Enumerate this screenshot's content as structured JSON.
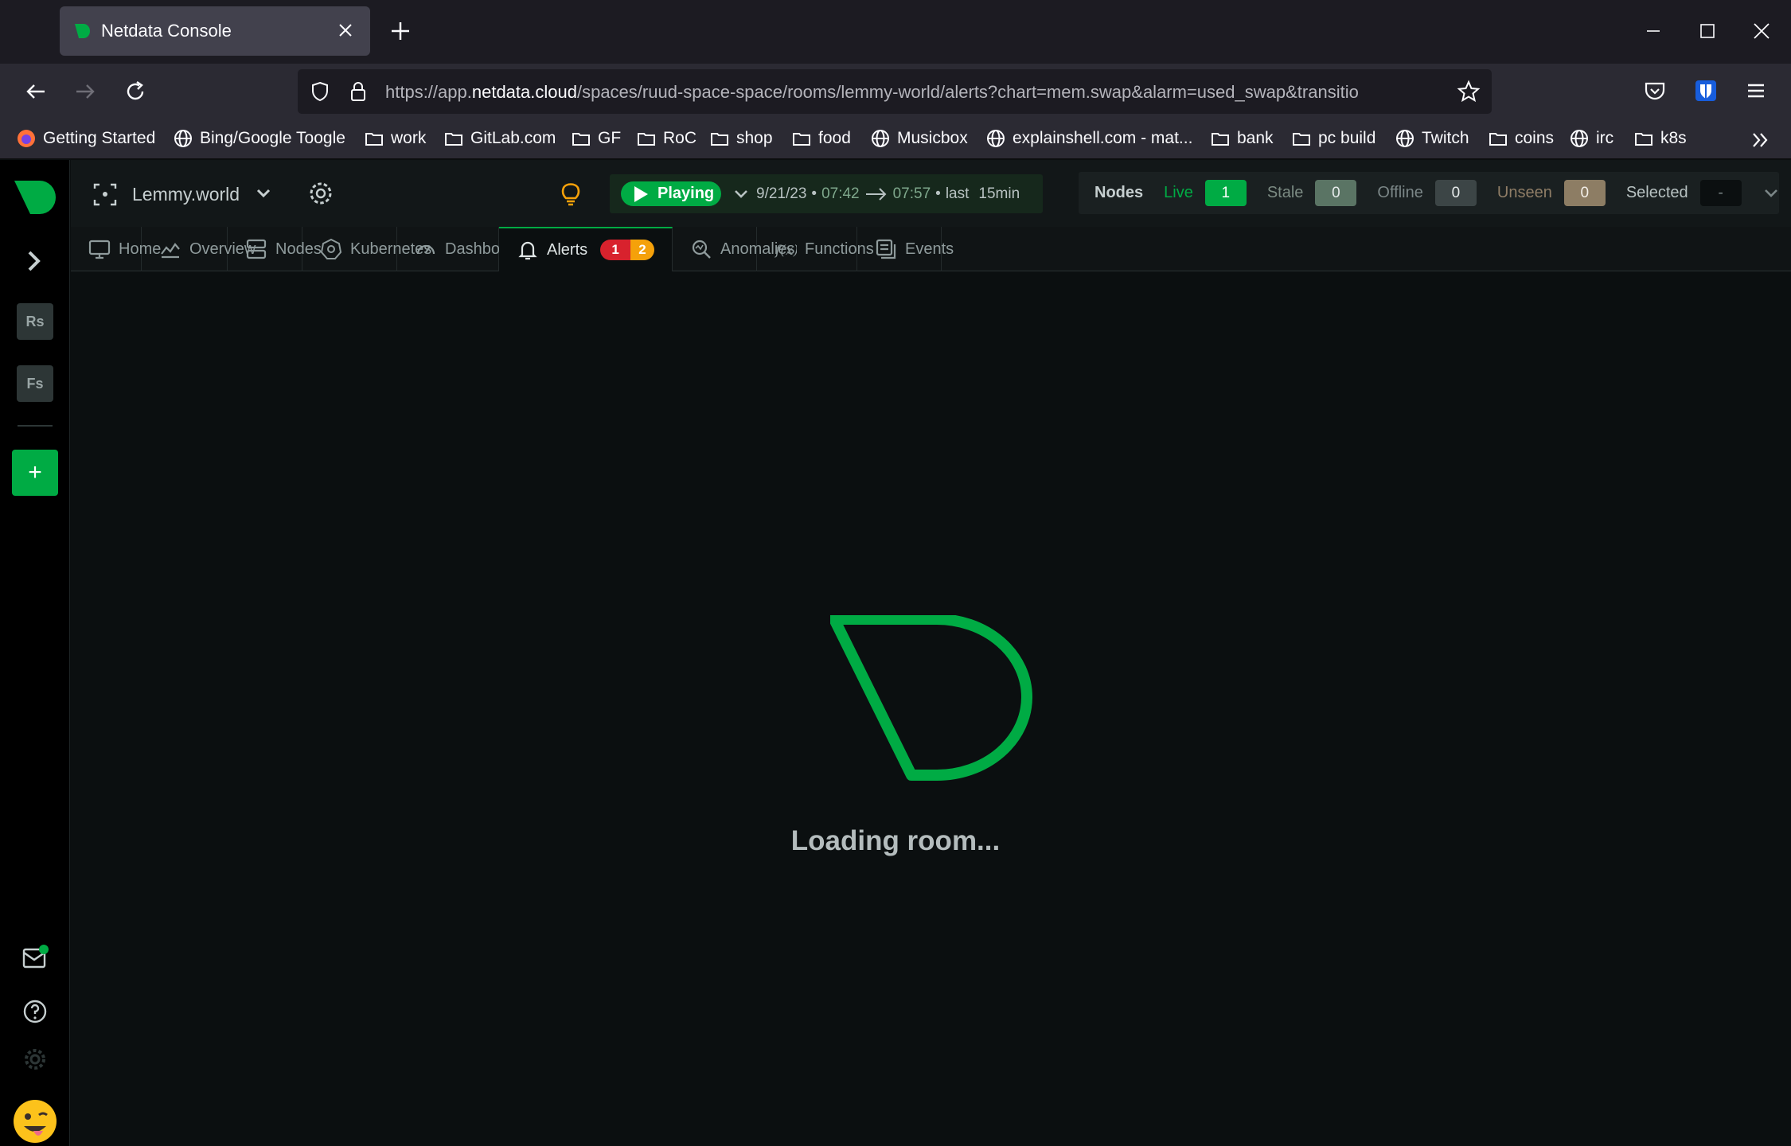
{
  "browser": {
    "tab_title": "Netdata Console",
    "url_prefix": "https://app.",
    "url_host": "netdata.cloud",
    "url_rest": "/spaces/ruud-space-space/rooms/lemmy-world/alerts?chart=mem.swap&alarm=used_swap&transitio"
  },
  "bookmarks": [
    {
      "icon": "firefox-icon",
      "label": "Getting Started"
    },
    {
      "icon": "globe-icon",
      "label": "Bing/Google Toogle"
    },
    {
      "icon": "folder-icon",
      "label": "work"
    },
    {
      "icon": "folder-icon",
      "label": "GitLab.com"
    },
    {
      "icon": "folder-icon",
      "label": "GF"
    },
    {
      "icon": "folder-icon",
      "label": "RoC"
    },
    {
      "icon": "folder-icon",
      "label": "shop"
    },
    {
      "icon": "folder-icon",
      "label": "food"
    },
    {
      "icon": "globe-icon",
      "label": "Musicbox"
    },
    {
      "icon": "globe-icon",
      "label": "explainshell.com - mat..."
    },
    {
      "icon": "folder-icon",
      "label": "bank"
    },
    {
      "icon": "folder-icon",
      "label": "pc build"
    },
    {
      "icon": "globe-icon",
      "label": "Twitch"
    },
    {
      "icon": "folder-icon",
      "label": "coins"
    },
    {
      "icon": "globe-icon",
      "label": "irc"
    },
    {
      "icon": "folder-icon",
      "label": "k8s"
    }
  ],
  "spaces": [
    "Rs",
    "Fs"
  ],
  "add_space_label": "+",
  "header": {
    "room_name": "Lemmy.world",
    "play_label": "Playing",
    "date": "9/21/23",
    "dot": "•",
    "from_time": "07:42",
    "to_time": "07:57",
    "last_label": "last",
    "duration": "15min"
  },
  "nodes": {
    "label": "Nodes",
    "live_label": "Live",
    "live_count": "1",
    "stale_label": "Stale",
    "stale_count": "0",
    "offline_label": "Offline",
    "offline_count": "0",
    "unseen_label": "Unseen",
    "unseen_count": "0",
    "selected_label": "Selected",
    "selected_value": "-"
  },
  "tabs": [
    {
      "icon": "monitor-icon",
      "label": "Home"
    },
    {
      "icon": "chart-icon",
      "label": "Overview"
    },
    {
      "icon": "nodes-icon",
      "label": "Nodes"
    },
    {
      "icon": "kubernetes-icon",
      "label": "Kubernetes"
    },
    {
      "icon": "gauge-icon",
      "label": "Dashboards"
    },
    {
      "icon": "bell-icon",
      "label": "Alerts"
    },
    {
      "icon": "anomaly-icon",
      "label": "Anomalies"
    },
    {
      "icon": "function-icon",
      "label": "Functions"
    },
    {
      "icon": "events-icon",
      "label": "Events"
    }
  ],
  "alerts_badge": {
    "critical": "1",
    "warning": "2"
  },
  "loading_text": "Loading room...",
  "colors": {
    "accent": "#00ab44",
    "critical": "#d8222d",
    "warning": "#f5a10a"
  }
}
